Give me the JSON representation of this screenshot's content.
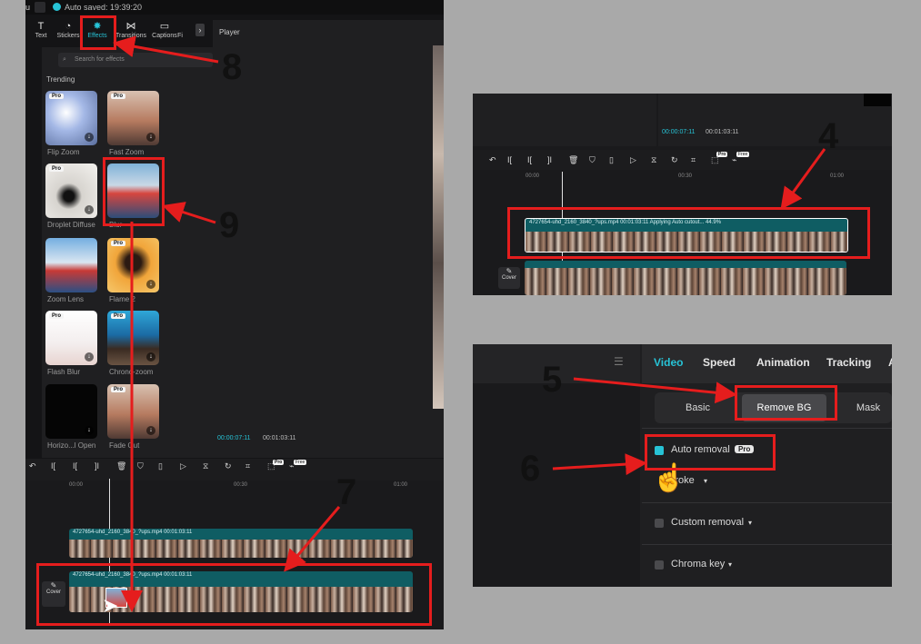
{
  "main_panel": {
    "menu_arrow": "u",
    "autosave": "Auto saved: 19:39:20",
    "tabs": [
      {
        "label": "Text",
        "icon": "text-icon"
      },
      {
        "label": "Stickers",
        "icon": "sticker-icon"
      },
      {
        "label": "Effects",
        "icon": "effects-icon"
      },
      {
        "label": "Transitions",
        "icon": "transition-icon"
      },
      {
        "label": "Captions",
        "icon": "captions-icon"
      },
      {
        "label": "Fi",
        "icon": "filter-icon"
      }
    ],
    "search_placeholder": "Search for effects",
    "section": "Trending",
    "effects": [
      {
        "label": "Flip Zoom",
        "pro": "Pro"
      },
      {
        "label": "Fast Zoom",
        "pro": "Pro"
      },
      {
        "label": "Droplet Diffuse",
        "pro": "Pro"
      },
      {
        "label": "Blur",
        "pro": ""
      },
      {
        "label": "Zoom Lens",
        "pro": ""
      },
      {
        "label": "Flame 2",
        "pro": "Pro"
      },
      {
        "label": "Flash Blur",
        "pro": "Pro"
      },
      {
        "label": "Chrono-zoom",
        "pro": "Pro"
      },
      {
        "label": "Horizo...l Open",
        "pro": ""
      },
      {
        "label": "Fade Out",
        "pro": "Pro"
      }
    ],
    "player_title": "Player",
    "player_time_current": "00:00:07:11",
    "player_time_total": "00:01:03:11",
    "ruler": [
      "00:00",
      "00:30",
      "01:00"
    ],
    "badges": [
      "Pro",
      "Free"
    ],
    "clip_top_meta": "4727654-uhd_2160_3840_?ups.mp4   00:01:03:11",
    "clip_bottom_meta": "4727654-uhd_2160_3840_?ups.mp4   00:01:03:11",
    "cover_label": "Cover"
  },
  "panel_4": {
    "time_current": "00:00:07:11",
    "time_total": "00:01:03:11",
    "ruler": [
      "00:00",
      "00:30",
      "01:00"
    ],
    "badges": [
      "Pro",
      "Free"
    ],
    "clip_meta": "4727654-uhd_2160_3840_?ups.mp4   00:01:03:11   Applying Auto cutout...   44.9%",
    "cover_label": "Cover"
  },
  "panel_5": {
    "tabs": [
      "Video",
      "Speed",
      "Animation",
      "Tracking",
      "A"
    ],
    "segments": [
      "Basic",
      "Remove BG",
      "Mask"
    ],
    "auto_removal": "Auto removal",
    "pro_badge": "Pro",
    "stroke": "Stroke",
    "custom_removal": "Custom removal",
    "chroma_key": "Chroma key"
  },
  "annotations": [
    "4",
    "5",
    "6",
    "7",
    "8",
    "9"
  ],
  "colors": {
    "accent": "#27c3d6",
    "annotation": "#e51d1d",
    "clip": "#0f5d63"
  }
}
